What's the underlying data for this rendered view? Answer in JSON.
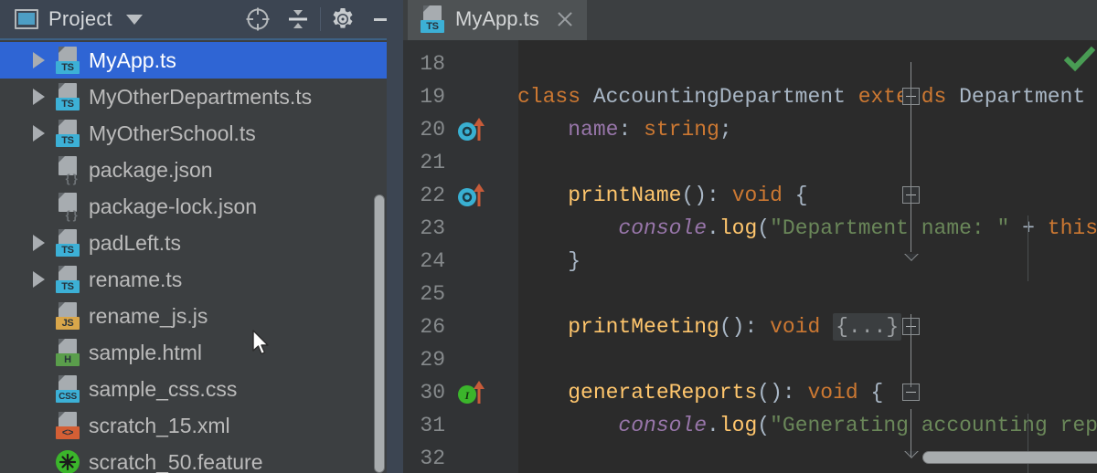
{
  "sidebar": {
    "header": {
      "title": "Project",
      "window_icon": "project-window-icon",
      "dropdown_icon": "chevron-down-icon",
      "actions": [
        {
          "name": "select-opened-file-icon",
          "label": "Select Opened File"
        },
        {
          "name": "collapse-all-icon",
          "label": "Collapse All"
        },
        {
          "name": "gear-icon",
          "label": "Settings"
        },
        {
          "name": "minimize-icon",
          "label": "Hide"
        }
      ]
    },
    "files": [
      {
        "name": "MyApp.ts",
        "badge": "TS",
        "badge_color": "#3cb0d6",
        "arrow": true,
        "selected": true,
        "icon": "file-icon"
      },
      {
        "name": "MyOtherDepartments.ts",
        "badge": "TS",
        "badge_color": "#3cb0d6",
        "arrow": true,
        "selected": false,
        "icon": "file-icon"
      },
      {
        "name": "MyOtherSchool.ts",
        "badge": "TS",
        "badge_color": "#3cb0d6",
        "arrow": true,
        "selected": false,
        "icon": "file-icon"
      },
      {
        "name": "package.json",
        "badge": "{ }",
        "badge_color": "none",
        "arrow": false,
        "selected": false,
        "icon": "json-file-icon"
      },
      {
        "name": "package-lock.json",
        "badge": "{ }",
        "badge_color": "none",
        "arrow": false,
        "selected": false,
        "icon": "json-file-icon"
      },
      {
        "name": "padLeft.ts",
        "badge": "TS",
        "badge_color": "#3cb0d6",
        "arrow": true,
        "selected": false,
        "icon": "file-icon"
      },
      {
        "name": "rename.ts",
        "badge": "TS",
        "badge_color": "#3cb0d6",
        "arrow": true,
        "selected": false,
        "icon": "file-icon"
      },
      {
        "name": "rename_js.js",
        "badge": "JS",
        "badge_color": "#d9a64a",
        "arrow": false,
        "selected": false,
        "icon": "file-icon"
      },
      {
        "name": "sample.html",
        "badge": "H",
        "badge_color": "#5a9e4b",
        "arrow": false,
        "selected": false,
        "icon": "file-icon"
      },
      {
        "name": "sample_css.css",
        "badge": "CSS",
        "badge_color": "#3cb0d6",
        "arrow": false,
        "selected": false,
        "icon": "file-icon"
      },
      {
        "name": "scratch_15.xml",
        "badge": "<>",
        "badge_color": "#d45f35",
        "arrow": false,
        "selected": false,
        "icon": "file-icon"
      },
      {
        "name": "scratch_50.feature",
        "badge": "",
        "badge_color": "#3bb52b",
        "arrow": false,
        "selected": false,
        "icon": "cucumber-icon"
      }
    ],
    "scrollbar": {
      "name": "sidebar-vertical-scrollbar"
    },
    "cursor": {
      "name": "mouse-pointer"
    }
  },
  "editor": {
    "tab": {
      "label": "MyApp.ts",
      "badge": "TS",
      "close_icon": "close-icon"
    },
    "status": {
      "inspection": "ok",
      "inspection_color": "#499c54"
    },
    "lines": [
      {
        "num": "18",
        "gutter": "",
        "fold": "",
        "html": ""
      },
      {
        "num": "19",
        "gutter": "",
        "fold": "minus",
        "html": "<span class=\"kw\">class</span> <span class=\"id\">AccountingDepartment</span> <span class=\"kw\">extends</span> <span class=\"id\">Department</span>"
      },
      {
        "num": "20",
        "gutter": "override",
        "fold": "",
        "html": "    <span class=\"fld\">name</span><span class=\"punct\">:</span> <span class=\"kw\">string</span><span class=\"punct\">;</span>"
      },
      {
        "num": "21",
        "gutter": "",
        "fold": "",
        "html": ""
      },
      {
        "num": "22",
        "gutter": "override",
        "fold": "minus",
        "html": "    <span class=\"fn\">printName</span><span class=\"punct\">():</span> <span class=\"kw\">void</span> <span class=\"punct\">{</span>"
      },
      {
        "num": "23",
        "gutter": "",
        "fold": "",
        "html": "        <span class=\"fld\" style=\"font-style:italic\">console</span><span class=\"punct\">.</span><span class=\"fn\">log</span><span class=\"punct\">(</span><span class=\"str\">\"Department name: \"</span> <span class=\"punct\">+</span> <span class=\"kw\">this</span>"
      },
      {
        "num": "24",
        "gutter": "",
        "fold": "end",
        "html": "    <span class=\"punct\">}</span>"
      },
      {
        "num": "25",
        "gutter": "",
        "fold": "",
        "html": ""
      },
      {
        "num": "26",
        "gutter": "",
        "fold": "plus",
        "html": "    <span class=\"fn\">printMeeting</span><span class=\"punct\">():</span> <span class=\"kw\">void</span> <span class=\"folded\">{...}</span>"
      },
      {
        "num": "29",
        "gutter": "",
        "fold": "",
        "html": ""
      },
      {
        "num": "30",
        "gutter": "implements",
        "fold": "minus",
        "html": "    <span class=\"fn\">generateReports</span><span class=\"punct\">():</span> <span class=\"kw\">void</span> <span class=\"punct\">{</span>"
      },
      {
        "num": "31",
        "gutter": "",
        "fold": "",
        "html": "        <span class=\"fld\" style=\"font-style:italic\">console</span><span class=\"punct\">.</span><span class=\"fn\">log</span><span class=\"punct\">(</span><span class=\"str\">\"Generating accounting rep</span>"
      },
      {
        "num": "32",
        "gutter": "",
        "fold": "end",
        "html": ""
      }
    ],
    "gutter_icons": {
      "override": {
        "name": "overriding-method-icon",
        "color": "#39b0d2",
        "arrow_color": "#c75b39"
      },
      "implements": {
        "name": "implementing-method-icon",
        "color": "#3bb52b",
        "arrow_color": "#c75b39"
      }
    },
    "hscrollbar": {
      "name": "editor-horizontal-scrollbar"
    }
  }
}
